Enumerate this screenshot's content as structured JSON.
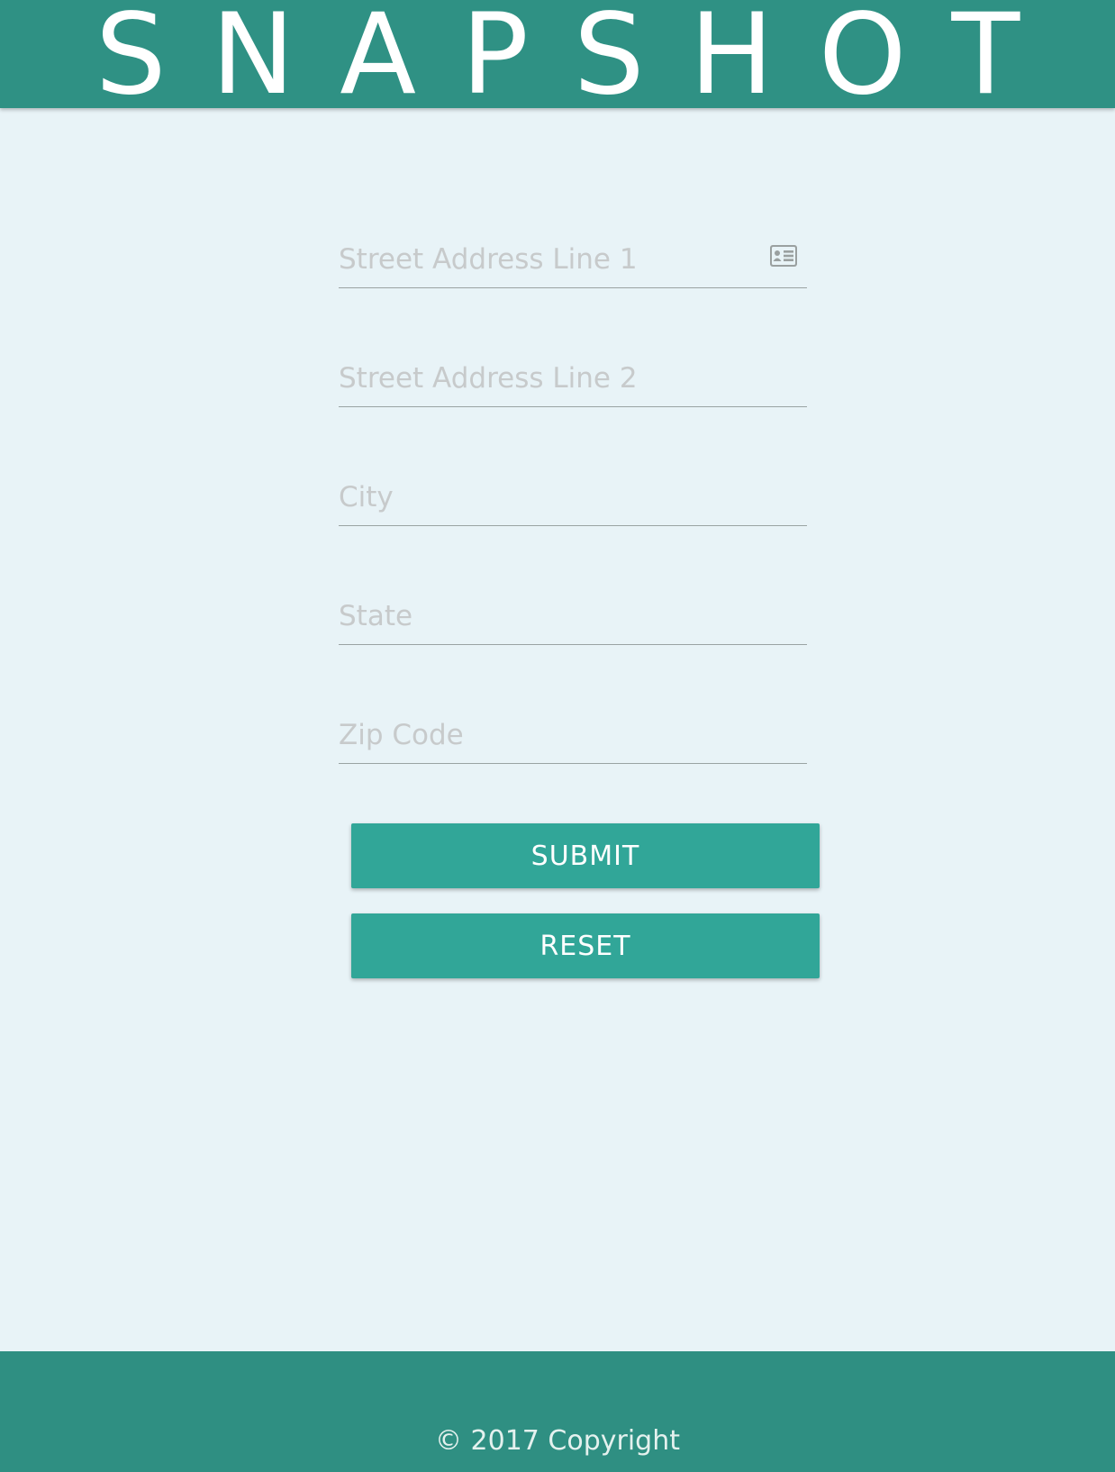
{
  "header": {
    "logo_text": "SNAPSHOT"
  },
  "form": {
    "fields": [
      {
        "placeholder": "Street Address Line 1",
        "value": "",
        "icon": "contact-card-icon"
      },
      {
        "placeholder": "Street Address Line 2",
        "value": ""
      },
      {
        "placeholder": "City",
        "value": ""
      },
      {
        "placeholder": "State",
        "value": ""
      },
      {
        "placeholder": "Zip Code",
        "value": ""
      }
    ],
    "submit_label": "SUBMIT",
    "reset_label": "RESET"
  },
  "footer": {
    "copyright": "© 2017 Copyright"
  },
  "colors": {
    "header_bg": "#2f9184",
    "button_bg": "#31a698",
    "page_bg": "#e8f3f7",
    "footer_bg": "#2f8f82"
  }
}
